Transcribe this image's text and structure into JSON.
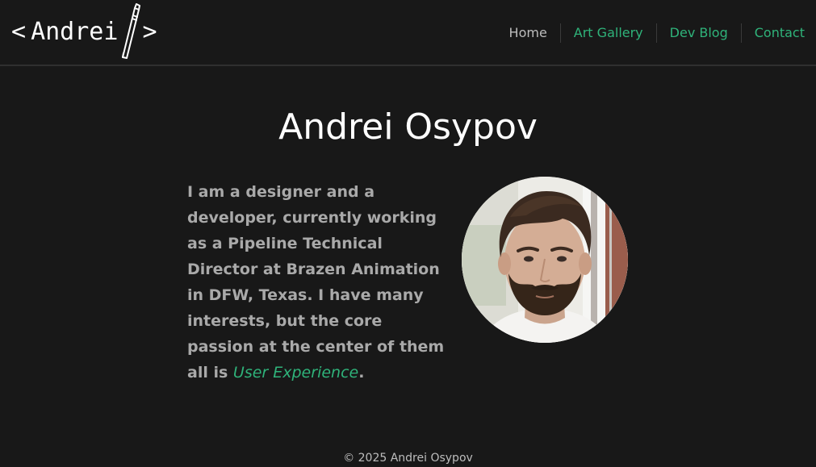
{
  "header": {
    "logo": {
      "left_bracket": "<",
      "name": "Andrei",
      "right_bracket": ">"
    },
    "nav": [
      {
        "label": "Home"
      },
      {
        "label": "Art Gallery"
      },
      {
        "label": "Dev Blog"
      },
      {
        "label": "Contact"
      }
    ]
  },
  "main": {
    "title": "Andrei Osypov",
    "bio_text": "I am a designer and a developer, currently working as a Pipeline Technical Director at Brazen Animation in DFW, Texas. I have many interests, but the core passion at the center of them all is ",
    "bio_highlight": "User Experience",
    "bio_end": "."
  },
  "footer": {
    "copyright": "© 2025 Andrei Osypov"
  },
  "colors": {
    "background": "#181818",
    "accent": "#2fb37a",
    "text_muted": "#a9a9a9",
    "nav_inactive": "#bdbdbd"
  }
}
